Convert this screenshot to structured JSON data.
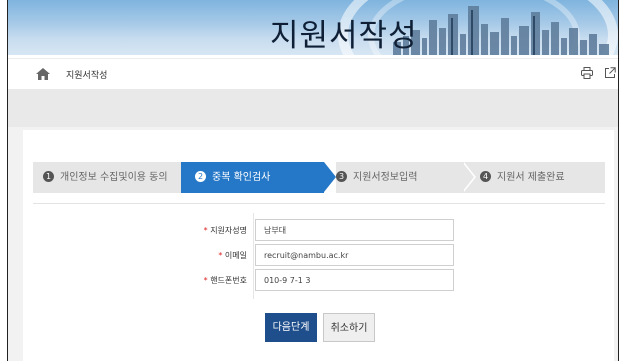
{
  "banner": {
    "title": "지원서작성"
  },
  "breadcrumb": {
    "current": "지원서작성"
  },
  "steps": [
    {
      "num": "1",
      "label": "개인정보 수집및이용 동의"
    },
    {
      "num": "2",
      "label": "중복 확인검사"
    },
    {
      "num": "3",
      "label": "지원서정보입력"
    },
    {
      "num": "4",
      "label": "지원서 제출완료"
    }
  ],
  "form": {
    "required_mark": "*",
    "name_label": "지원자성명",
    "name_value": "남부대",
    "email_label": "이메일",
    "email_value": "recruit@nambu.ac.kr",
    "phone_label": "핸드폰번호",
    "phone_value": "010-9  7-1  3"
  },
  "buttons": {
    "next": "다음단계",
    "cancel": "취소하기"
  },
  "colors": {
    "active_step": "#2578c8",
    "next_button": "#1f4e8c",
    "required": "#d22222"
  }
}
